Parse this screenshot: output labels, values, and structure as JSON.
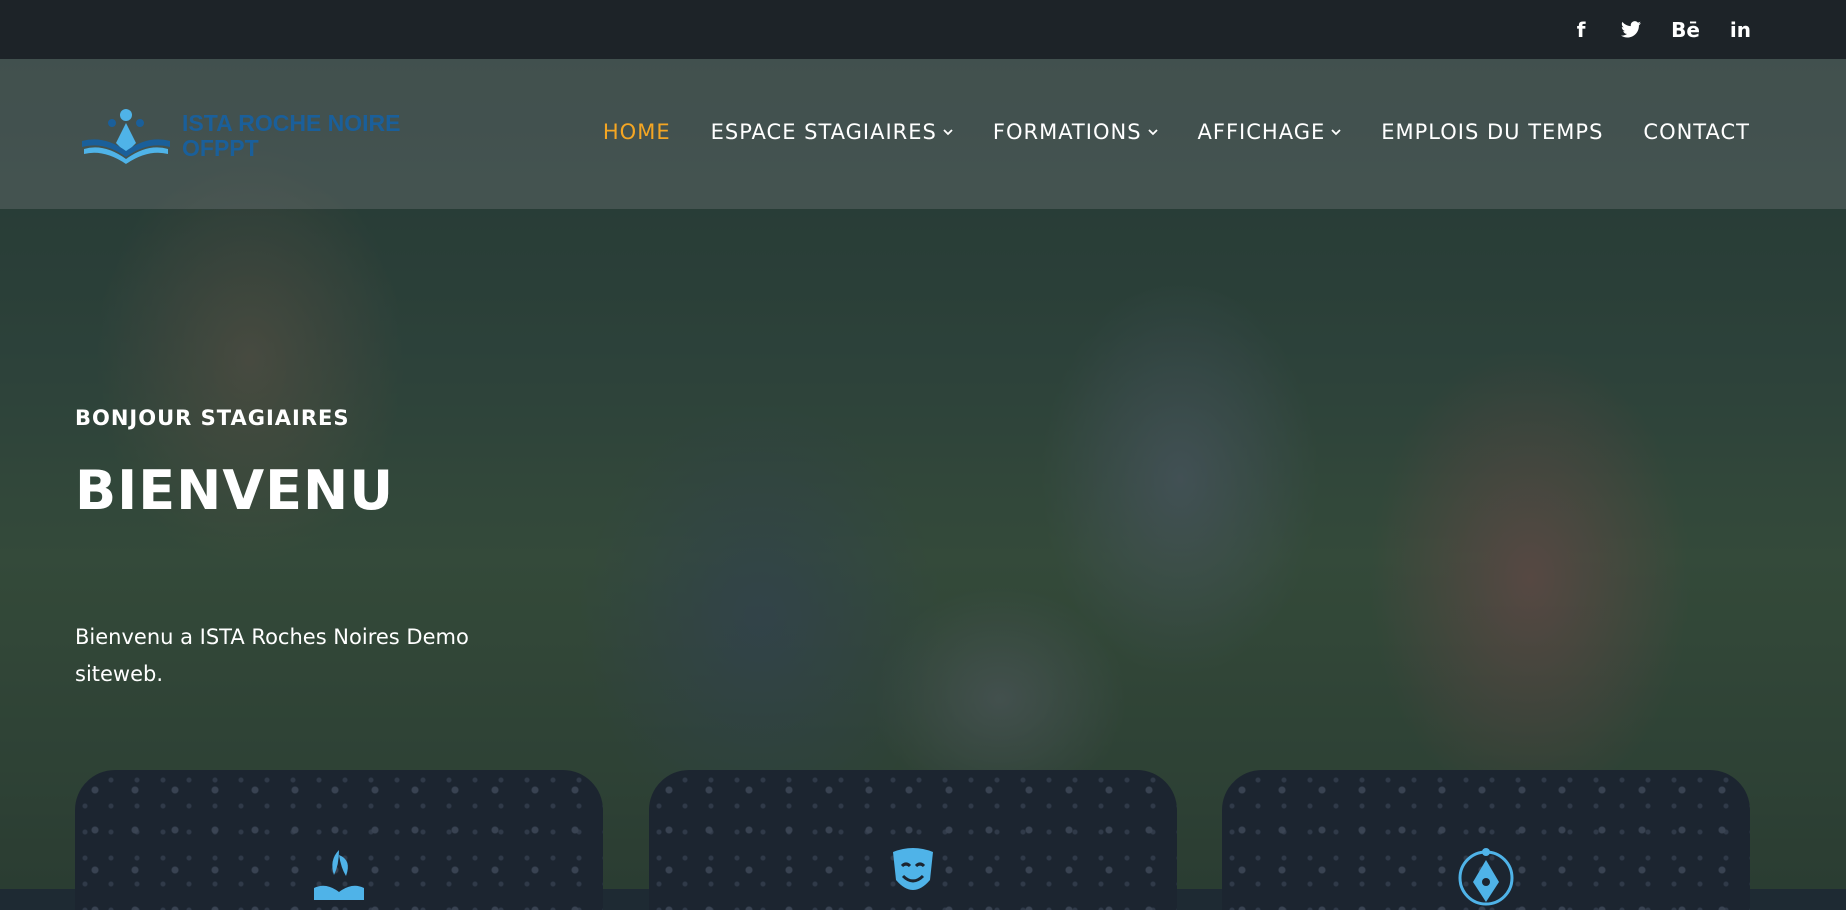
{
  "social": {
    "facebook": "f",
    "twitter": "twitter-icon",
    "behance": "Bē",
    "linkedin": "in"
  },
  "logo": {
    "line1": "ISTA ROCHE NOIRE",
    "line2": "OFPPT"
  },
  "nav": {
    "items": [
      {
        "label": "HOME",
        "active": true,
        "dropdown": false
      },
      {
        "label": "ESPACE STAGIAIRES",
        "active": false,
        "dropdown": true
      },
      {
        "label": "FORMATIONS",
        "active": false,
        "dropdown": true
      },
      {
        "label": "AFFICHAGE",
        "active": false,
        "dropdown": true
      },
      {
        "label": "EMPLOIS DU TEMPS",
        "active": false,
        "dropdown": false
      },
      {
        "label": "CONTACT",
        "active": false,
        "dropdown": false
      }
    ]
  },
  "hero": {
    "subtitle": "BONJOUR STAGIAIRES",
    "title": "BIENVENU",
    "text": "Bienvenu a ISTA Roches Noires Demo siteweb."
  },
  "cards": [
    {
      "icon": "plant-book-icon"
    },
    {
      "icon": "theater-masks-icon"
    },
    {
      "icon": "pen-nib-icon"
    }
  ],
  "colors": {
    "accent": "#f5a623",
    "topbar": "#1d2328",
    "logo_blue": "#1a5f9a",
    "icon_blue": "#4fb3e8"
  }
}
